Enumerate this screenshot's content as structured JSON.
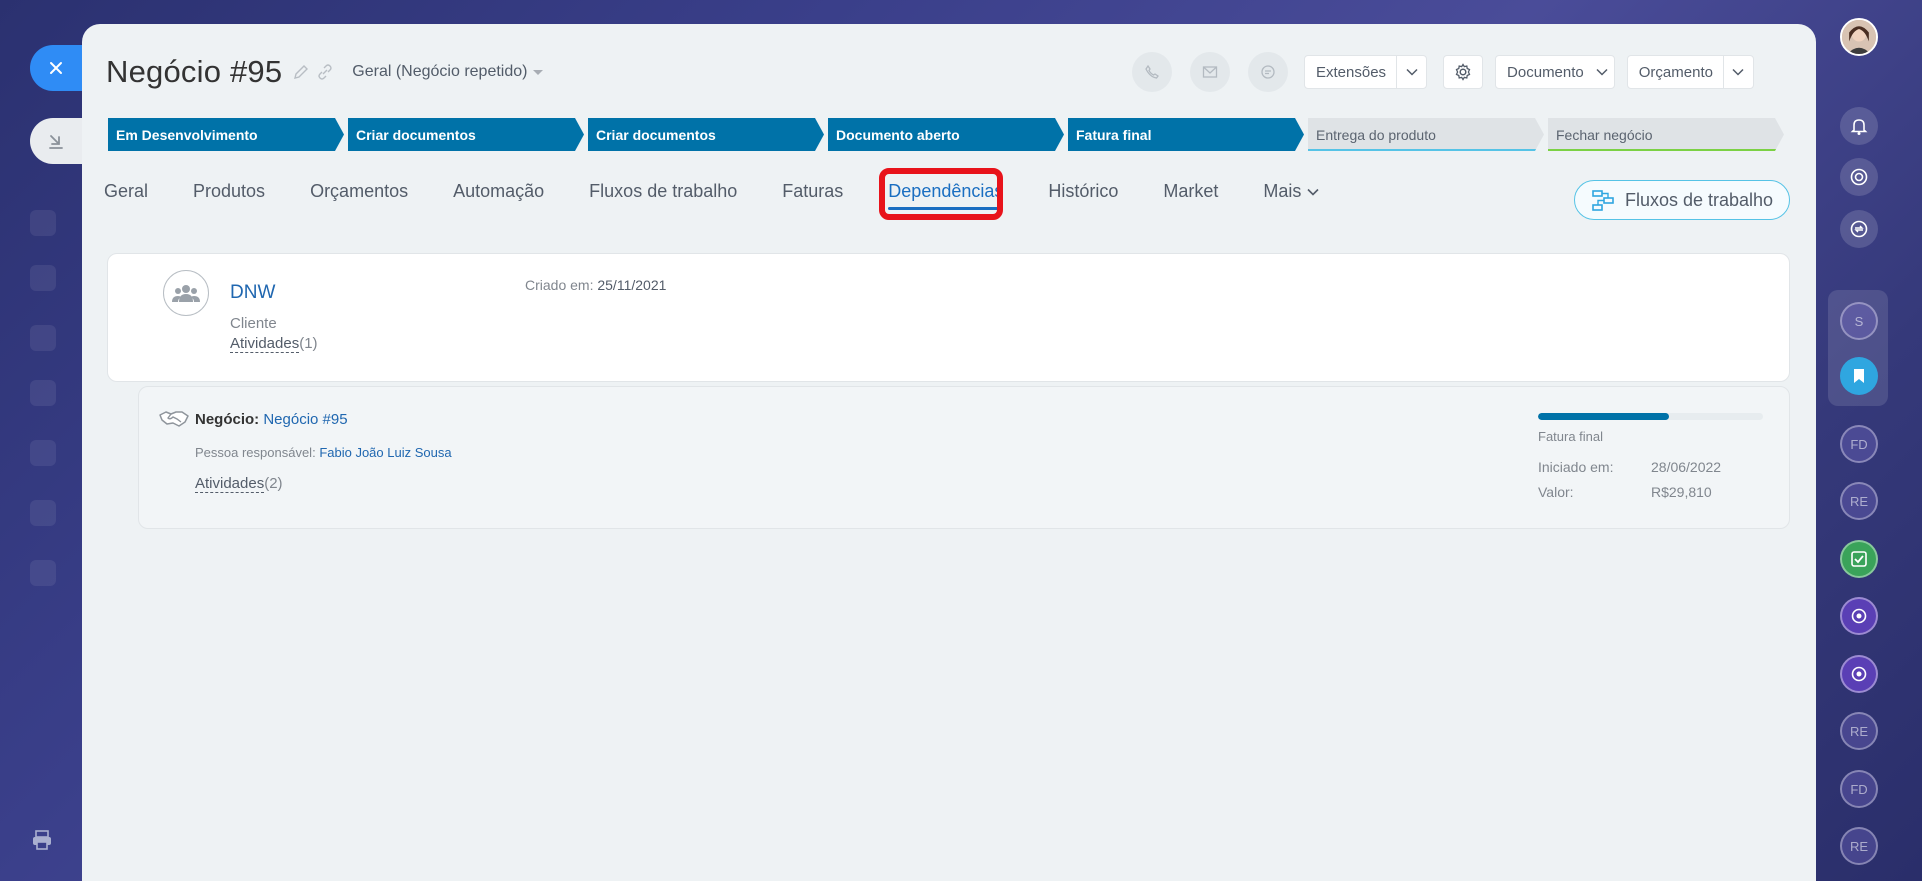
{
  "header": {
    "title": "Negócio #95",
    "category": "Geral (Negócio repetido)"
  },
  "toolbar": {
    "extensions_label": "Extensões",
    "document_label": "Documento",
    "quote_label": "Orçamento"
  },
  "stages": [
    {
      "label": "Em Desenvolvimento",
      "state": "active"
    },
    {
      "label": "Criar documentos",
      "state": "active"
    },
    {
      "label": "Criar documentos",
      "state": "active"
    },
    {
      "label": "Documento aberto",
      "state": "active"
    },
    {
      "label": "Fatura final",
      "state": "active"
    },
    {
      "label": "Entrega do produto",
      "state": "inactive"
    },
    {
      "label": "Fechar negócio",
      "state": "inactive"
    }
  ],
  "tabs": [
    {
      "label": "Geral"
    },
    {
      "label": "Produtos"
    },
    {
      "label": "Orçamentos"
    },
    {
      "label": "Automação"
    },
    {
      "label": "Fluxos de trabalho"
    },
    {
      "label": "Faturas"
    },
    {
      "label": "Dependências",
      "active": true
    },
    {
      "label": "Histórico"
    },
    {
      "label": "Market"
    },
    {
      "label": "Mais"
    }
  ],
  "workflow_button": "Fluxos de trabalho",
  "client_card": {
    "name": "DNW",
    "type": "Cliente",
    "activities_label": "Atividades",
    "activities_count": "(1)",
    "created_label": "Criado em:",
    "created_value": "25/11/2021"
  },
  "deal_card": {
    "deal_label": "Negócio:",
    "deal_link": "Negócio #95",
    "responsible_label": "Pessoa responsável:",
    "responsible_name": "Fabio João Luiz Sousa",
    "activities_label": "Atividades",
    "activities_count": "(2)",
    "progress_fraction": 0.58,
    "stage_name": "Fatura final",
    "started_label": "Iniciado em:",
    "started_value": "28/06/2022",
    "amount_label": "Valor:",
    "amount_value": "R$29,810"
  },
  "right_rail": [
    {
      "initials": "S"
    },
    {
      "initials": "FD"
    },
    {
      "initials": "RE"
    },
    {
      "initials": "RE"
    },
    {
      "initials": "FD"
    },
    {
      "initials": "RE"
    }
  ],
  "colors": {
    "stage_active": "#0072a8",
    "stage_inactive": "#dfe3e6",
    "link": "#2067b0",
    "highlight": "#e8131b",
    "close_button": "#2f8cf5"
  }
}
